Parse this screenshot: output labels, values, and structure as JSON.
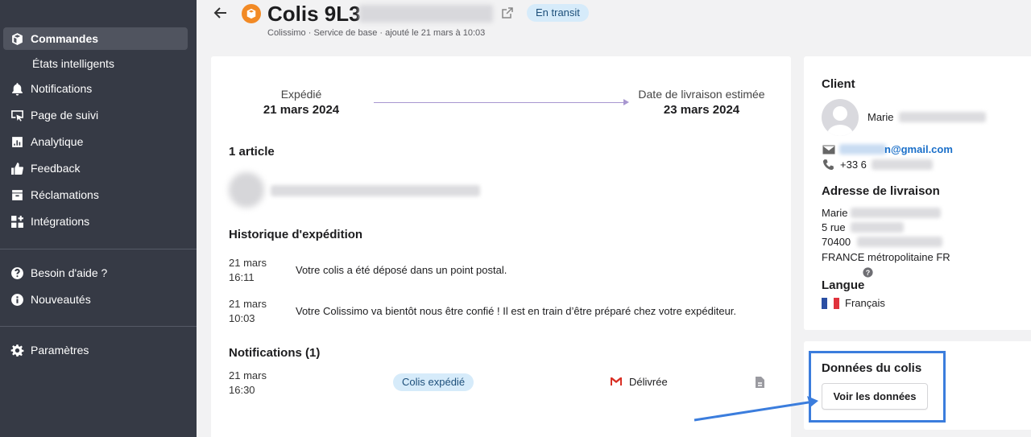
{
  "sidebar": {
    "items": [
      {
        "label": "Commandes",
        "icon": "box-icon"
      },
      {
        "label": "États intelligents"
      },
      {
        "label": "Notifications",
        "icon": "bell-icon"
      },
      {
        "label": "Page de suivi",
        "icon": "tracking-page-icon"
      },
      {
        "label": "Analytique",
        "icon": "chart-icon"
      },
      {
        "label": "Feedback",
        "icon": "thumbs-up-icon"
      },
      {
        "label": "Réclamations",
        "icon": "inbox-icon"
      },
      {
        "label": "Intégrations",
        "icon": "grid-plus-icon"
      },
      {
        "label": "Besoin d'aide ?",
        "icon": "help-icon"
      },
      {
        "label": "Nouveautés",
        "icon": "info-icon"
      },
      {
        "label": "Paramètres",
        "icon": "gear-icon"
      }
    ]
  },
  "header": {
    "title": "Colis 9L3",
    "status": "En transit",
    "subtitle": "Colissimo · Service de base · ajouté le 21 mars à 10:03"
  },
  "shipment": {
    "shipped_label": "Expédié",
    "shipped_date": "21 mars 2024",
    "eta_label": "Date de livraison estimée",
    "eta_date": "23 mars 2024"
  },
  "articles": {
    "title": "1 article"
  },
  "history": {
    "title": "Historique d'expédition",
    "events": [
      {
        "date": "21 mars",
        "time": "16:11",
        "text": "Votre colis a été déposé dans un point postal."
      },
      {
        "date": "21 mars",
        "time": "10:03",
        "text": "Votre Colissimo va bientôt nous être confié ! Il est en train d’être préparé chez votre expéditeur."
      }
    ]
  },
  "notifications": {
    "title": "Notifications (1)",
    "items": [
      {
        "date": "21 mars",
        "time": "16:30",
        "type": "Colis expédié",
        "status": "Délivrée"
      }
    ]
  },
  "client": {
    "title": "Client",
    "name": "Marie",
    "email": "n@gmail.com",
    "phone": "+33 6",
    "address_title": "Adresse de livraison",
    "address": [
      "Marie",
      "5 rue",
      "70400",
      "FRANCE métropolitaine FR"
    ],
    "language_title": "Langue",
    "language": "Français"
  },
  "package_data": {
    "title": "Données du colis",
    "button": "Voir les données"
  },
  "colors": {
    "sidebar_bg": "#363a45",
    "accent_badge": "#d6ebfa",
    "highlight": "#3b7ddd",
    "brand_orange": "#f28a25"
  }
}
